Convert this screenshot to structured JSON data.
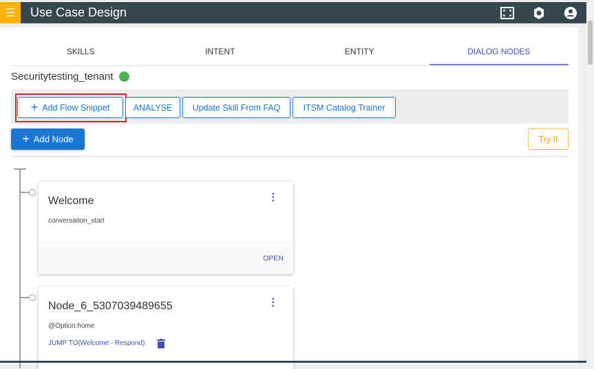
{
  "app": {
    "title": "Use Case Design",
    "accent": "#ffb300",
    "header_bg": "#37474f"
  },
  "header_icons": [
    "fullscreen-icon",
    "settings-icon",
    "account-icon"
  ],
  "tabs": [
    {
      "label": "SKILLS"
    },
    {
      "label": "INTENT"
    },
    {
      "label": "ENTITY"
    },
    {
      "label": "DIALOG NODES",
      "active": true
    }
  ],
  "tenant": {
    "name": "Securitytesting_tenant",
    "status_color": "#4caf50"
  },
  "toolbar": {
    "add_flow_snippet": "Add Flow Snippet",
    "analyse": "ANALYSE",
    "update_skill": "Update Skill From FAQ",
    "itsm": "ITSM Catalog Trainer"
  },
  "actions": {
    "add_node": "Add Node",
    "try_it": "Try It"
  },
  "nodes": [
    {
      "title": "Welcome",
      "condition": "conversation_start",
      "footer_action": "OPEN"
    },
    {
      "title": "Node_6_5307039489655",
      "condition": "@Option:home",
      "jump": "JUMP TO(Welcome - Respond)"
    }
  ]
}
